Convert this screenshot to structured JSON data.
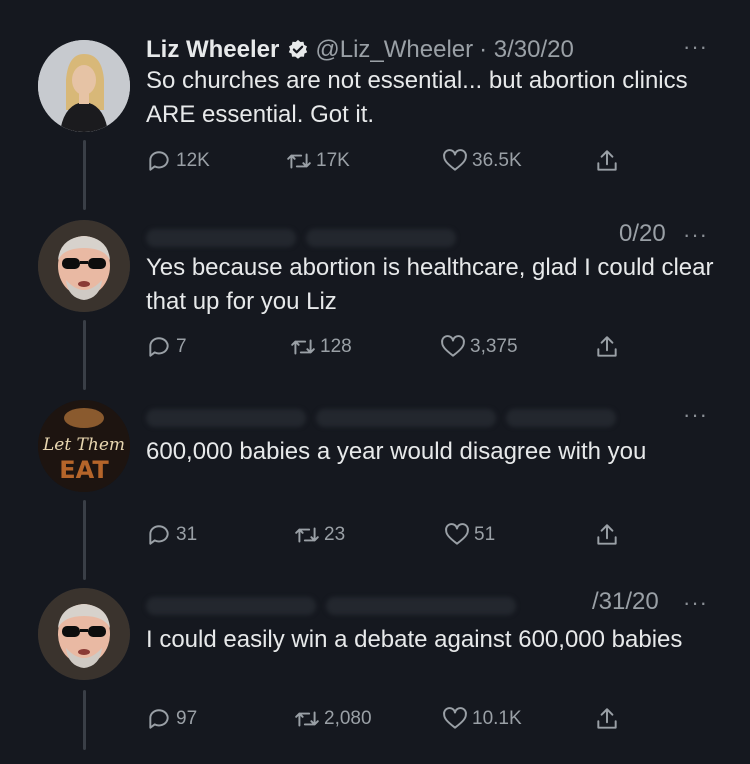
{
  "tweets": [
    {
      "name": "Liz Wheeler",
      "handle": "@Liz_Wheeler",
      "date": "· 3/30/20",
      "text": "So churches are not essential... but abortion clinics ARE essential. Got it.",
      "replies": "12K",
      "retweets": "17K",
      "likes": "36.5K",
      "more": "···"
    },
    {
      "date": "0/20",
      "text": "Yes because abortion is healthcare, glad I could clear that up for you Liz",
      "replies": "7",
      "retweets": "128",
      "likes": "3,375",
      "more": "···"
    },
    {
      "avatar_text": "Let Them",
      "avatar_logo": "EAT",
      "text": "600,000 babies a year would disagree with you",
      "replies": "31",
      "retweets": "23",
      "likes": "51",
      "more": "···"
    },
    {
      "date": "/31/20",
      "text": "I could easily win a debate against 600,000 babies",
      "replies": "97",
      "retweets": "2,080",
      "likes": "10.1K",
      "more": "···"
    }
  ],
  "colors": {
    "background": "#15181f",
    "text": "#e7e9ea",
    "muted": "#9aa0a6",
    "verified": "#e7e9ea"
  },
  "icons": [
    "reply-icon",
    "retweet-icon",
    "like-icon",
    "share-icon",
    "verified-icon",
    "more-icon"
  ]
}
